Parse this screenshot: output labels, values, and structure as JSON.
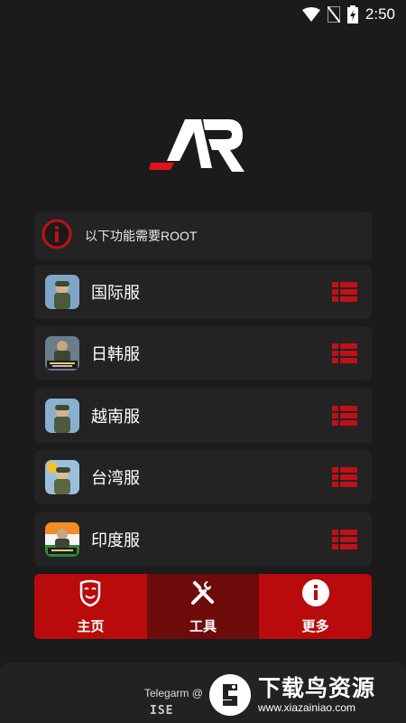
{
  "status_bar": {
    "time": "2:50",
    "icons": [
      "wifi-icon",
      "no-sim-icon",
      "battery-charging-icon"
    ]
  },
  "logo": {
    "text": "AR",
    "colors": {
      "white": "#ffffff",
      "red": "#e0121b"
    }
  },
  "notice": {
    "icon": "info-circle-icon",
    "text": "以下功能需要ROOT"
  },
  "servers": [
    {
      "label": "国际服",
      "icon": "pubg-global-icon",
      "action_icon": "list-menu-icon"
    },
    {
      "label": "日韩服",
      "icon": "pubg-kr-jp-icon",
      "action_icon": "list-menu-icon"
    },
    {
      "label": "越南服",
      "icon": "pubg-vn-icon",
      "action_icon": "list-menu-icon"
    },
    {
      "label": "台湾服",
      "icon": "pubg-tw-icon",
      "action_icon": "list-menu-icon"
    },
    {
      "label": "印度服",
      "icon": "pubg-in-icon",
      "action_icon": "list-menu-icon"
    }
  ],
  "bottom_nav": [
    {
      "label": "主页",
      "icon": "mask-icon",
      "active": false
    },
    {
      "label": "工具",
      "icon": "tools-icon",
      "active": true
    },
    {
      "label": "更多",
      "icon": "info-icon",
      "active": false
    }
  ],
  "footer": {
    "text": "Telegarm @",
    "badge": "ISE"
  },
  "watermark": {
    "title": "下载鸟资源",
    "url": "www.xiazainiao.com"
  },
  "colors": {
    "accent": "#b90b0b",
    "accent_active": "#6e0b0b",
    "background": "#1b1b1b",
    "card": "#232323"
  }
}
